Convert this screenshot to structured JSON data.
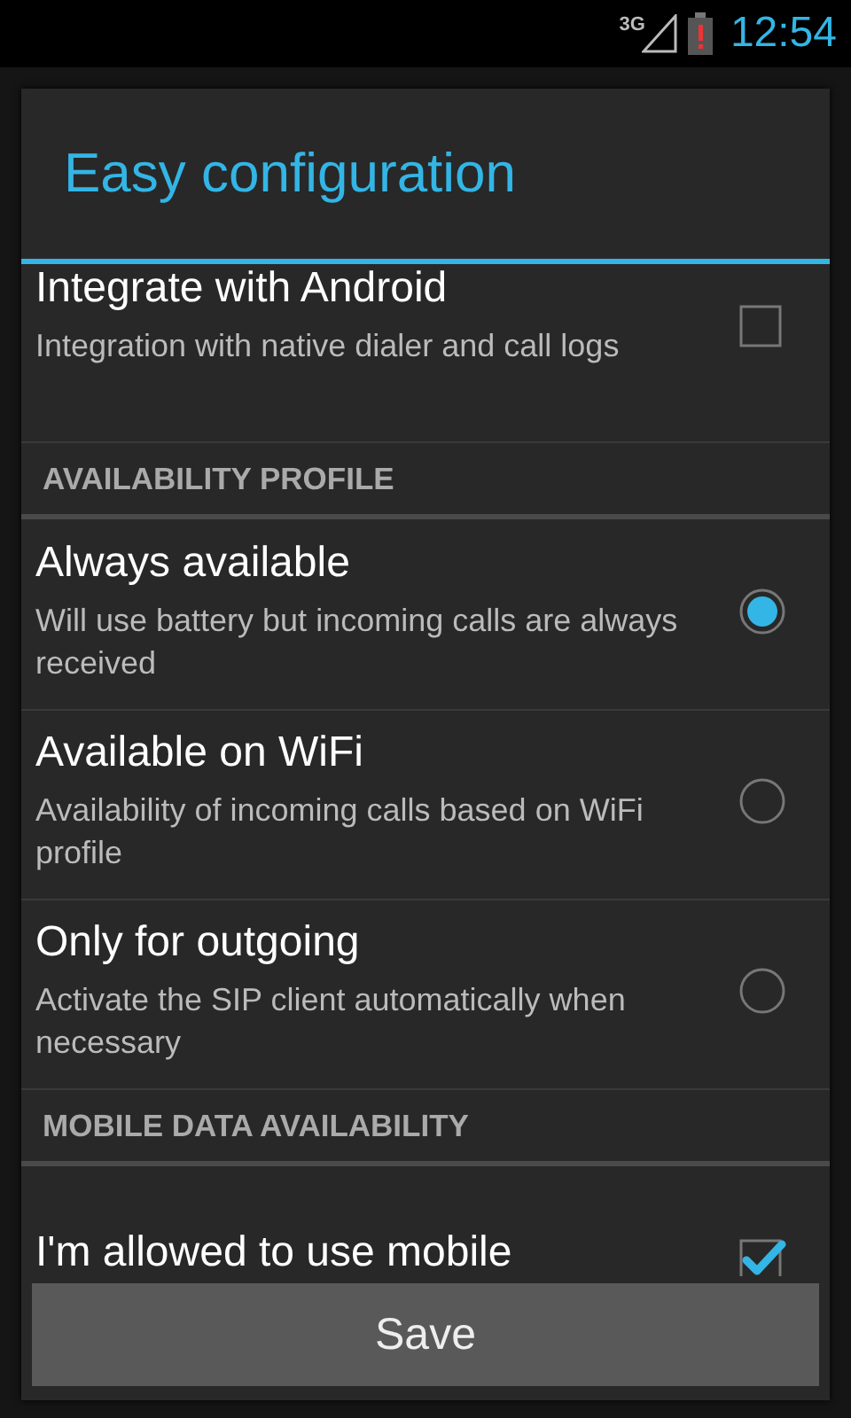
{
  "status_bar": {
    "network": "3G",
    "time": "12:54"
  },
  "dialog": {
    "title": "Easy configuration",
    "items": [
      {
        "kind": "checkbox",
        "title": "Integrate with Android",
        "summary": "Integration with native dialer and call logs",
        "checked": false
      },
      {
        "kind": "header",
        "title": "AVAILABILITY PROFILE"
      },
      {
        "kind": "radio",
        "title": "Always available",
        "summary": "Will use battery but incoming calls are always received",
        "selected": true
      },
      {
        "kind": "radio",
        "title": "Available on WiFi",
        "summary": "Availability of incoming calls based on WiFi profile",
        "selected": false
      },
      {
        "kind": "radio",
        "title": "Only for outgoing",
        "summary": "Activate the SIP client automatically when necessary",
        "selected": false
      },
      {
        "kind": "header",
        "title": "MOBILE DATA AVAILABILITY"
      },
      {
        "kind": "checkbox",
        "title": "I'm allowed to use mobile",
        "checked": true
      }
    ],
    "button": "Save"
  }
}
